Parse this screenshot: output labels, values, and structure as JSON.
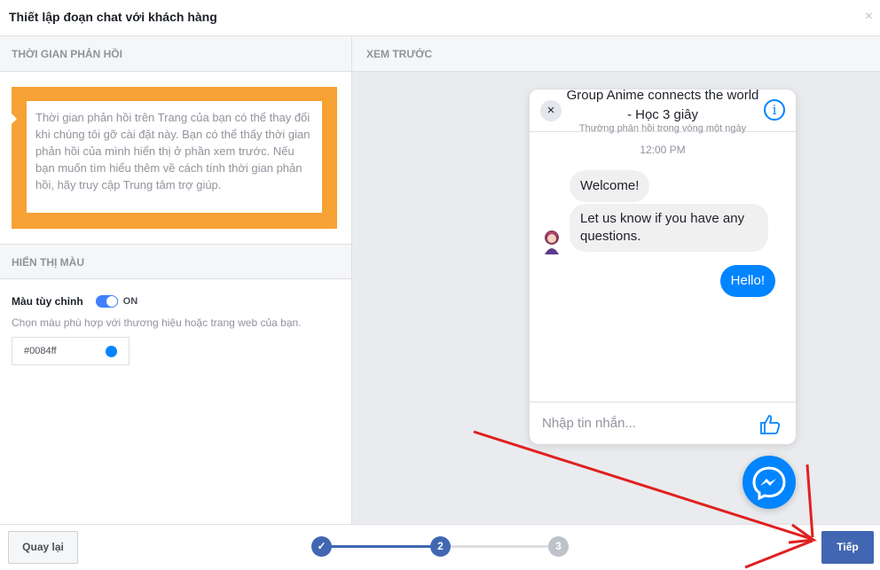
{
  "dialog": {
    "title": "Thiết lập đoạn chat với khách hàng",
    "close_glyph": "×"
  },
  "left": {
    "response_time_header": "THỜI GIAN PHẢN HỒI",
    "response_time_notice": "Thời gian phản hồi trên Trang của bạn có thể thay đổi khi chúng tôi gỡ cài đặt này. Bạn có thể thấy thời gian phản hồi của mình hiển thị ở phần xem trước. Nếu bạn muốn tìm hiểu thêm về cách tính thời gian phản hồi, hãy truy cập Trung tâm trợ giúp.",
    "color_header": "HIỂN THỊ MÀU",
    "custom_color_label": "Màu tùy chỉnh",
    "toggle_state": "ON",
    "color_help": "Chọn màu phù hợp với thương hiệu hoặc trang web của bạn.",
    "color_value": "#0084ff"
  },
  "preview": {
    "header": "XEM TRƯỚC",
    "chat_title": "Group Anime connects the world - Học 3 giây",
    "chat_subtitle": "Thường phản hồi trong vòng một ngày",
    "time": "12:00 PM",
    "messages_in": [
      "Welcome!",
      "Let us know if you have any questions."
    ],
    "message_out": "Hello!",
    "input_placeholder": "Nhập tin nhắn...",
    "close_glyph": "×",
    "info_glyph": "i"
  },
  "footer": {
    "back_label": "Quay lại",
    "next_label": "Tiếp",
    "steps": [
      {
        "label": "✓",
        "state": "done"
      },
      {
        "label": "2",
        "state": "current"
      },
      {
        "label": "3",
        "state": "pending"
      }
    ]
  },
  "colors": {
    "accent": "#0084ff",
    "orange": "#f7a234",
    "primary_button": "#4267b2",
    "annotation_arrow": "#e02020"
  },
  "icons": [
    "close-icon",
    "info-icon",
    "like-icon",
    "messenger-icon",
    "check-icon"
  ]
}
